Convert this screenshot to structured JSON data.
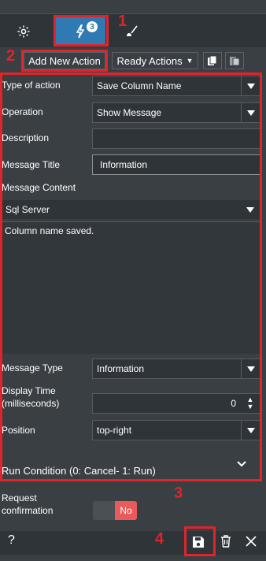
{
  "tabs": {
    "settings_icon": "gear-icon",
    "actions_icon": "lightning-icon",
    "actions_badge": "3",
    "brush_icon": "brush-icon"
  },
  "toolbar": {
    "add_new_action": "Add New Action",
    "ready_actions": "Ready Actions",
    "copy_icon": "copy-icon",
    "paste_icon": "paste-icon"
  },
  "form": {
    "type_of_action": {
      "label": "Type of action",
      "value": "Save Column Name"
    },
    "operation": {
      "label": "Operation",
      "value": "Show Message"
    },
    "description": {
      "label": "Description",
      "value": ""
    },
    "message_title": {
      "label": "Message Title",
      "value": "Information"
    },
    "message_content": {
      "label": "Message Content",
      "language": "Sql Server",
      "text": "Column name saved."
    },
    "message_type": {
      "label": "Message Type",
      "value": "Information"
    },
    "display_time": {
      "label_line1": "Display Time",
      "label_line2": "(milliseconds)",
      "value": "0"
    },
    "position": {
      "label": "Position",
      "value": "top-right"
    },
    "run_condition": {
      "label": "Run Condition (0: Cancel- 1: Run)"
    },
    "request_confirmation": {
      "label_line1": "Request",
      "label_line2": "confirmation",
      "toggle": "No"
    }
  },
  "annotations": [
    "1",
    "2",
    "3",
    "4"
  ],
  "bottom": {
    "help": "?",
    "save_icon": "save-icon",
    "delete_icon": "trash-icon",
    "close_icon": "close-icon"
  },
  "colors": {
    "accent": "#2f7ab3",
    "annotation_red": "#e0242b",
    "toggle_no": "#e95b5b",
    "panel_bg": "#3a3f44"
  }
}
